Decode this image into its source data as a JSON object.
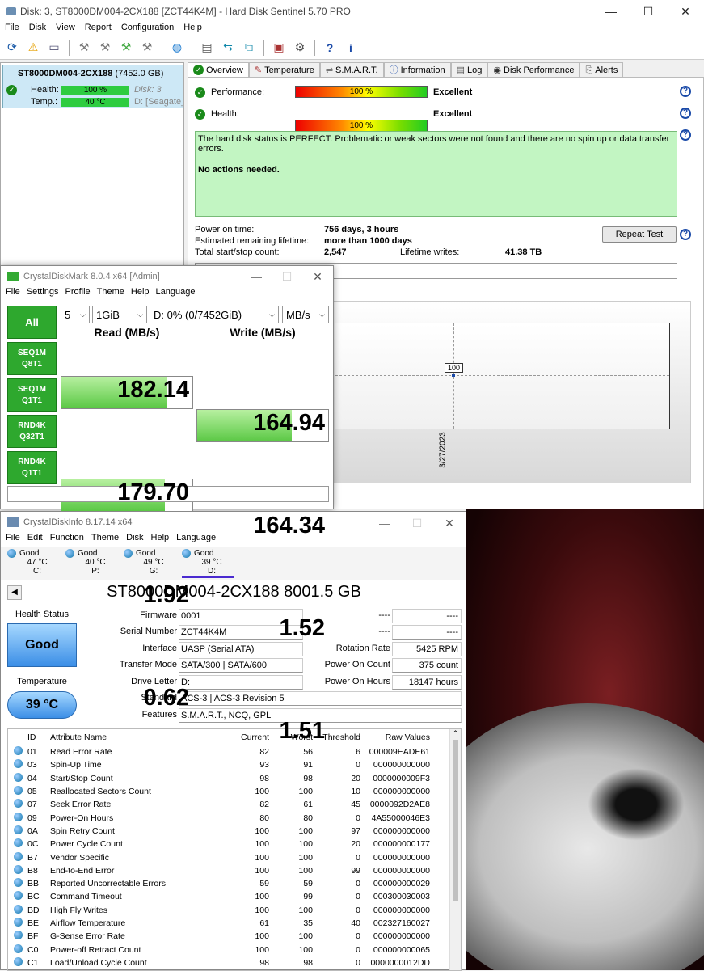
{
  "hds": {
    "title": "Disk: 3, ST8000DM004-2CX188 [ZCT44K4M] - Hard Disk Sentinel 5.70 PRO",
    "menu": [
      "File",
      "Disk",
      "View",
      "Report",
      "Configuration",
      "Help"
    ],
    "disk": {
      "name": "ST8000DM004-2CX188",
      "size": "(7452.0 GB)",
      "health_label": "Health:",
      "health": "100 %",
      "disk_no": "Disk: 3",
      "temp_label": "Temp.:",
      "temp": "40 °C",
      "drive": "D: [Seagate_8"
    },
    "tabs": [
      "Overview",
      "Temperature",
      "S.M.A.R.T.",
      "Information",
      "Log",
      "Disk Performance",
      "Alerts"
    ],
    "performance": {
      "label": "Performance:",
      "value": "100 %",
      "rating": "Excellent",
      "level": 1.0
    },
    "health": {
      "label": "Health:",
      "value": "100 %",
      "rating": "Excellent",
      "level": 1.0
    },
    "status_text": "The hard disk status is PERFECT. Problematic or weak sectors were not found and there are no spin up or data transfer errors.",
    "action_text": "No actions needed.",
    "power_on_label": "Power on time:",
    "power_on": "756 days, 3 hours",
    "lifetime_label": "Estimated remaining lifetime:",
    "lifetime": "more than 1000 days",
    "startstop_label": "Total start/stop count:",
    "startstop": "2,547",
    "writes_label": "Lifetime writes:",
    "writes": "41.38 TB",
    "repeat_button": "Repeat Test",
    "chart_point": "100",
    "chart_date": "3/27/2023"
  },
  "cdm": {
    "title": "CrystalDiskMark 8.0.4 x64 [Admin]",
    "menu": [
      "File",
      "Settings",
      "Profile",
      "Theme",
      "Help",
      "Language"
    ],
    "all_label": "All",
    "count": "5",
    "size": "1GiB",
    "drive": "D: 0% (0/7452GiB)",
    "unit": "MB/s",
    "read_header": "Read (MB/s)",
    "write_header": "Write (MB/s)",
    "rows": [
      {
        "l1": "SEQ1M",
        "l2": "Q8T1",
        "read": "182.14",
        "write": "164.94",
        "rf": 0.8,
        "wf": 0.72
      },
      {
        "l1": "SEQ1M",
        "l2": "Q1T1",
        "read": "179.70",
        "write": "164.34",
        "rf": 0.79,
        "wf": 0.72
      },
      {
        "l1": "RND4K",
        "l2": "Q32T1",
        "read": "1.92",
        "write": "1.52",
        "rf": 0.2,
        "wf": 0.18
      },
      {
        "l1": "RND4K",
        "l2": "Q1T1",
        "read": "0.62",
        "write": "1.51",
        "rf": 0.12,
        "wf": 0.18
      }
    ]
  },
  "cdi": {
    "title": "CrystalDiskInfo 8.17.14 x64",
    "menu": [
      "File",
      "Edit",
      "Function",
      "Theme",
      "Disk",
      "Help",
      "Language"
    ],
    "drives": [
      {
        "s": "Good",
        "t": "47 °C",
        "d": "C:"
      },
      {
        "s": "Good",
        "t": "40 °C",
        "d": "P:"
      },
      {
        "s": "Good",
        "t": "49 °C",
        "d": "G:"
      },
      {
        "s": "Good",
        "t": "39 °C",
        "d": "D:"
      }
    ],
    "model": "ST8000DM004-2CX188 8001.5 GB",
    "health_label": "Health Status",
    "health": "Good",
    "temp_label": "Temperature",
    "temp": "39 °C",
    "firmware_l": "Firmware",
    "firmware": "0001",
    "serial_l": "Serial Number",
    "serial": "ZCT44K4M",
    "interface_l": "Interface",
    "interface": "UASP (Serial ATA)",
    "transfer_l": "Transfer Mode",
    "transfer": "SATA/300 | SATA/600",
    "letter_l": "Drive Letter",
    "letter": "D:",
    "standard_l": "Standard",
    "standard": "ACS-3 | ACS-3 Revision 5",
    "features_l": "Features",
    "features": "S.M.A.R.T., NCQ, GPL",
    "dash": "----",
    "rotation_l": "Rotation Rate",
    "rotation": "5425 RPM",
    "poc_l": "Power On Count",
    "poc": "375 count",
    "poh_l": "Power On Hours",
    "poh": "18147 hours",
    "cols": [
      "ID",
      "Attribute Name",
      "Current",
      "Worst",
      "Threshold",
      "Raw Values"
    ],
    "attrs": [
      [
        "01",
        "Read Error Rate",
        "82",
        "56",
        "6",
        "000009EADE61"
      ],
      [
        "03",
        "Spin-Up Time",
        "93",
        "91",
        "0",
        "000000000000"
      ],
      [
        "04",
        "Start/Stop Count",
        "98",
        "98",
        "20",
        "0000000009F3"
      ],
      [
        "05",
        "Reallocated Sectors Count",
        "100",
        "100",
        "10",
        "000000000000"
      ],
      [
        "07",
        "Seek Error Rate",
        "82",
        "61",
        "45",
        "0000092D2AE8"
      ],
      [
        "09",
        "Power-On Hours",
        "80",
        "80",
        "0",
        "4A55000046E3"
      ],
      [
        "0A",
        "Spin Retry Count",
        "100",
        "100",
        "97",
        "000000000000"
      ],
      [
        "0C",
        "Power Cycle Count",
        "100",
        "100",
        "20",
        "000000000177"
      ],
      [
        "B7",
        "Vendor Specific",
        "100",
        "100",
        "0",
        "000000000000"
      ],
      [
        "B8",
        "End-to-End Error",
        "100",
        "100",
        "99",
        "000000000000"
      ],
      [
        "BB",
        "Reported Uncorrectable Errors",
        "59",
        "59",
        "0",
        "000000000029"
      ],
      [
        "BC",
        "Command Timeout",
        "100",
        "99",
        "0",
        "000300030003"
      ],
      [
        "BD",
        "High Fly Writes",
        "100",
        "100",
        "0",
        "000000000000"
      ],
      [
        "BE",
        "Airflow Temperature",
        "61",
        "35",
        "40",
        "002327160027"
      ],
      [
        "BF",
        "G-Sense Error Rate",
        "100",
        "100",
        "0",
        "000000000000"
      ],
      [
        "C0",
        "Power-off Retract Count",
        "100",
        "100",
        "0",
        "000000000065"
      ],
      [
        "C1",
        "Load/Unload Cycle Count",
        "98",
        "98",
        "0",
        "0000000012DD"
      ]
    ]
  }
}
